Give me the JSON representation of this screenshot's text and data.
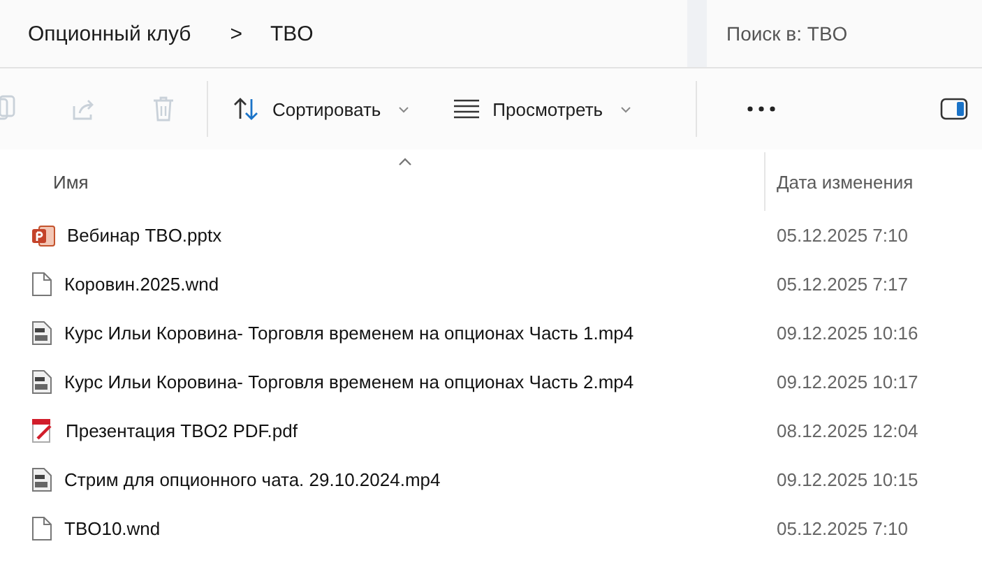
{
  "address_bar": {
    "path": [
      "Опционный клуб",
      "TBO"
    ],
    "separator": ">"
  },
  "search": {
    "placeholder": "Поиск в: TBO"
  },
  "toolbar": {
    "icon_buttons": [
      {
        "kind": "copy",
        "disabled": true
      },
      {
        "kind": "share",
        "disabled": true
      },
      {
        "kind": "delete",
        "disabled": true
      }
    ],
    "menus": [
      {
        "kind": "sort",
        "label": "Сортировать"
      },
      {
        "kind": "view",
        "label": "Просмотреть"
      }
    ]
  },
  "table": {
    "columns": [
      {
        "label": "Имя",
        "sorted": true
      },
      {
        "label": "Дата изменения",
        "sorted": false
      }
    ],
    "rows": [
      {
        "kind": "pptx",
        "name": "Вебинар TBO.pptx",
        "date": "05.12.2025 7:10"
      },
      {
        "kind": "file",
        "name": "Коровин.2025.wnd",
        "date": "05.12.2025 7:17"
      },
      {
        "kind": "video",
        "name": "Курс Ильи Коровина- Торговля временем на опционах Часть 1.mp4",
        "date": "09.12.2025 10:16"
      },
      {
        "kind": "video",
        "name": "Курс Ильи Коровина- Торговля временем на опционах Часть 2.mp4",
        "date": "09.12.2025 10:17"
      },
      {
        "kind": "pdf",
        "name": "Презентация TBO2 PDF.pdf",
        "date": "08.12.2025 12:04"
      },
      {
        "kind": "video",
        "name": "Стрим для опционного чата. 29.10.2024.mp4",
        "date": "09.12.2025 10:15"
      },
      {
        "kind": "file",
        "name": "TBO10.wnd",
        "date": "05.12.2025 7:10"
      }
    ]
  }
}
